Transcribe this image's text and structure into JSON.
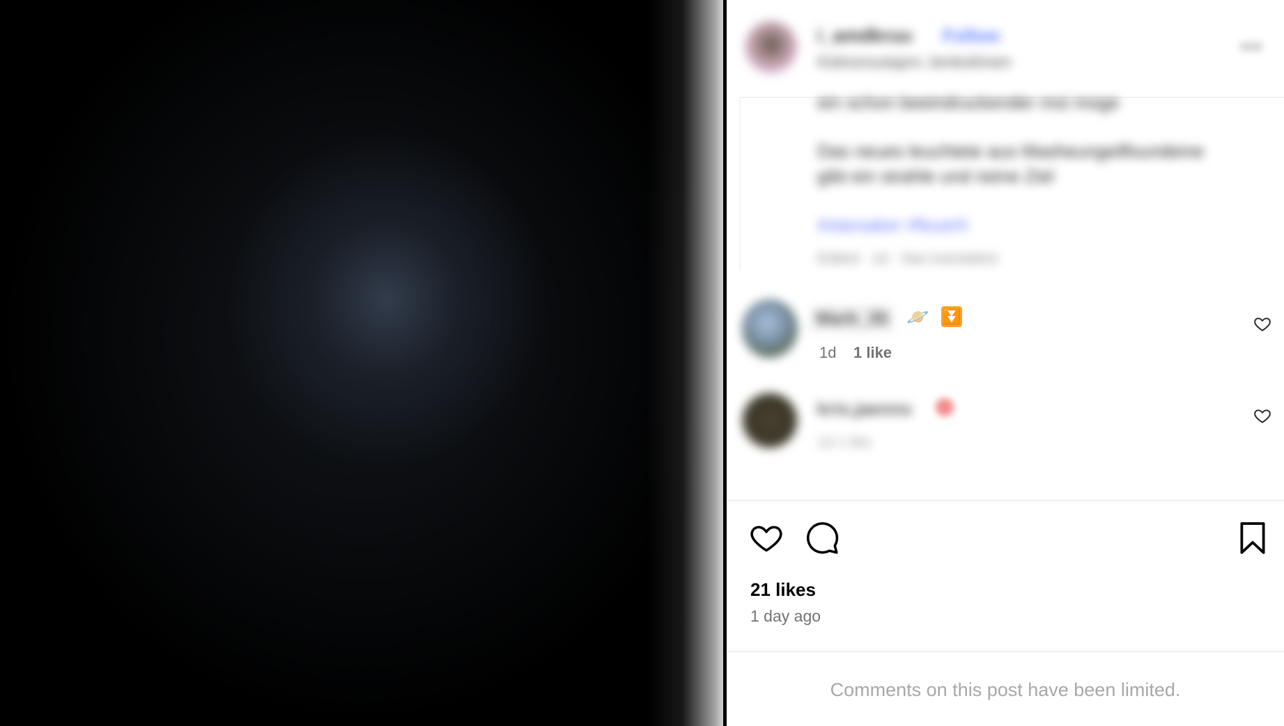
{
  "post": {
    "caption": {
      "username": "i_amdkruu",
      "follow_label": "Follow",
      "audio": "Kidnoroutapro Jenkolimen",
      "lines": [
        "ein schon beeindruckender moi moge",
        "Das neues leuchtete aus Masheungeilfoundeine",
        "gibt ein strahle und neine Ziel"
      ],
      "hashtags": "#starsaker #feuerh",
      "meta": "Edited · 1d · See translation"
    },
    "comments": [
      {
        "username": "Mark_35",
        "emojis": [
          "🪐",
          "⏬"
        ],
        "time": "1d",
        "likes": "1 like"
      },
      {
        "username": "kris.jaenns",
        "time": "1d",
        "likes": "1 like"
      }
    ],
    "likes_count": "21 likes",
    "age": "1 day ago",
    "comments_limited": "Comments on this post have been limited."
  },
  "colors": {
    "text": "#000000",
    "secondary": "#737373",
    "muted": "#a8a8a8",
    "divider": "#efefef",
    "media_bg": "#000000"
  },
  "icons": {
    "like": "heart-icon",
    "comment": "speech-bubble-icon",
    "save": "bookmark-icon",
    "more": "more-dots-icon",
    "comment_like": "heart-icon"
  }
}
